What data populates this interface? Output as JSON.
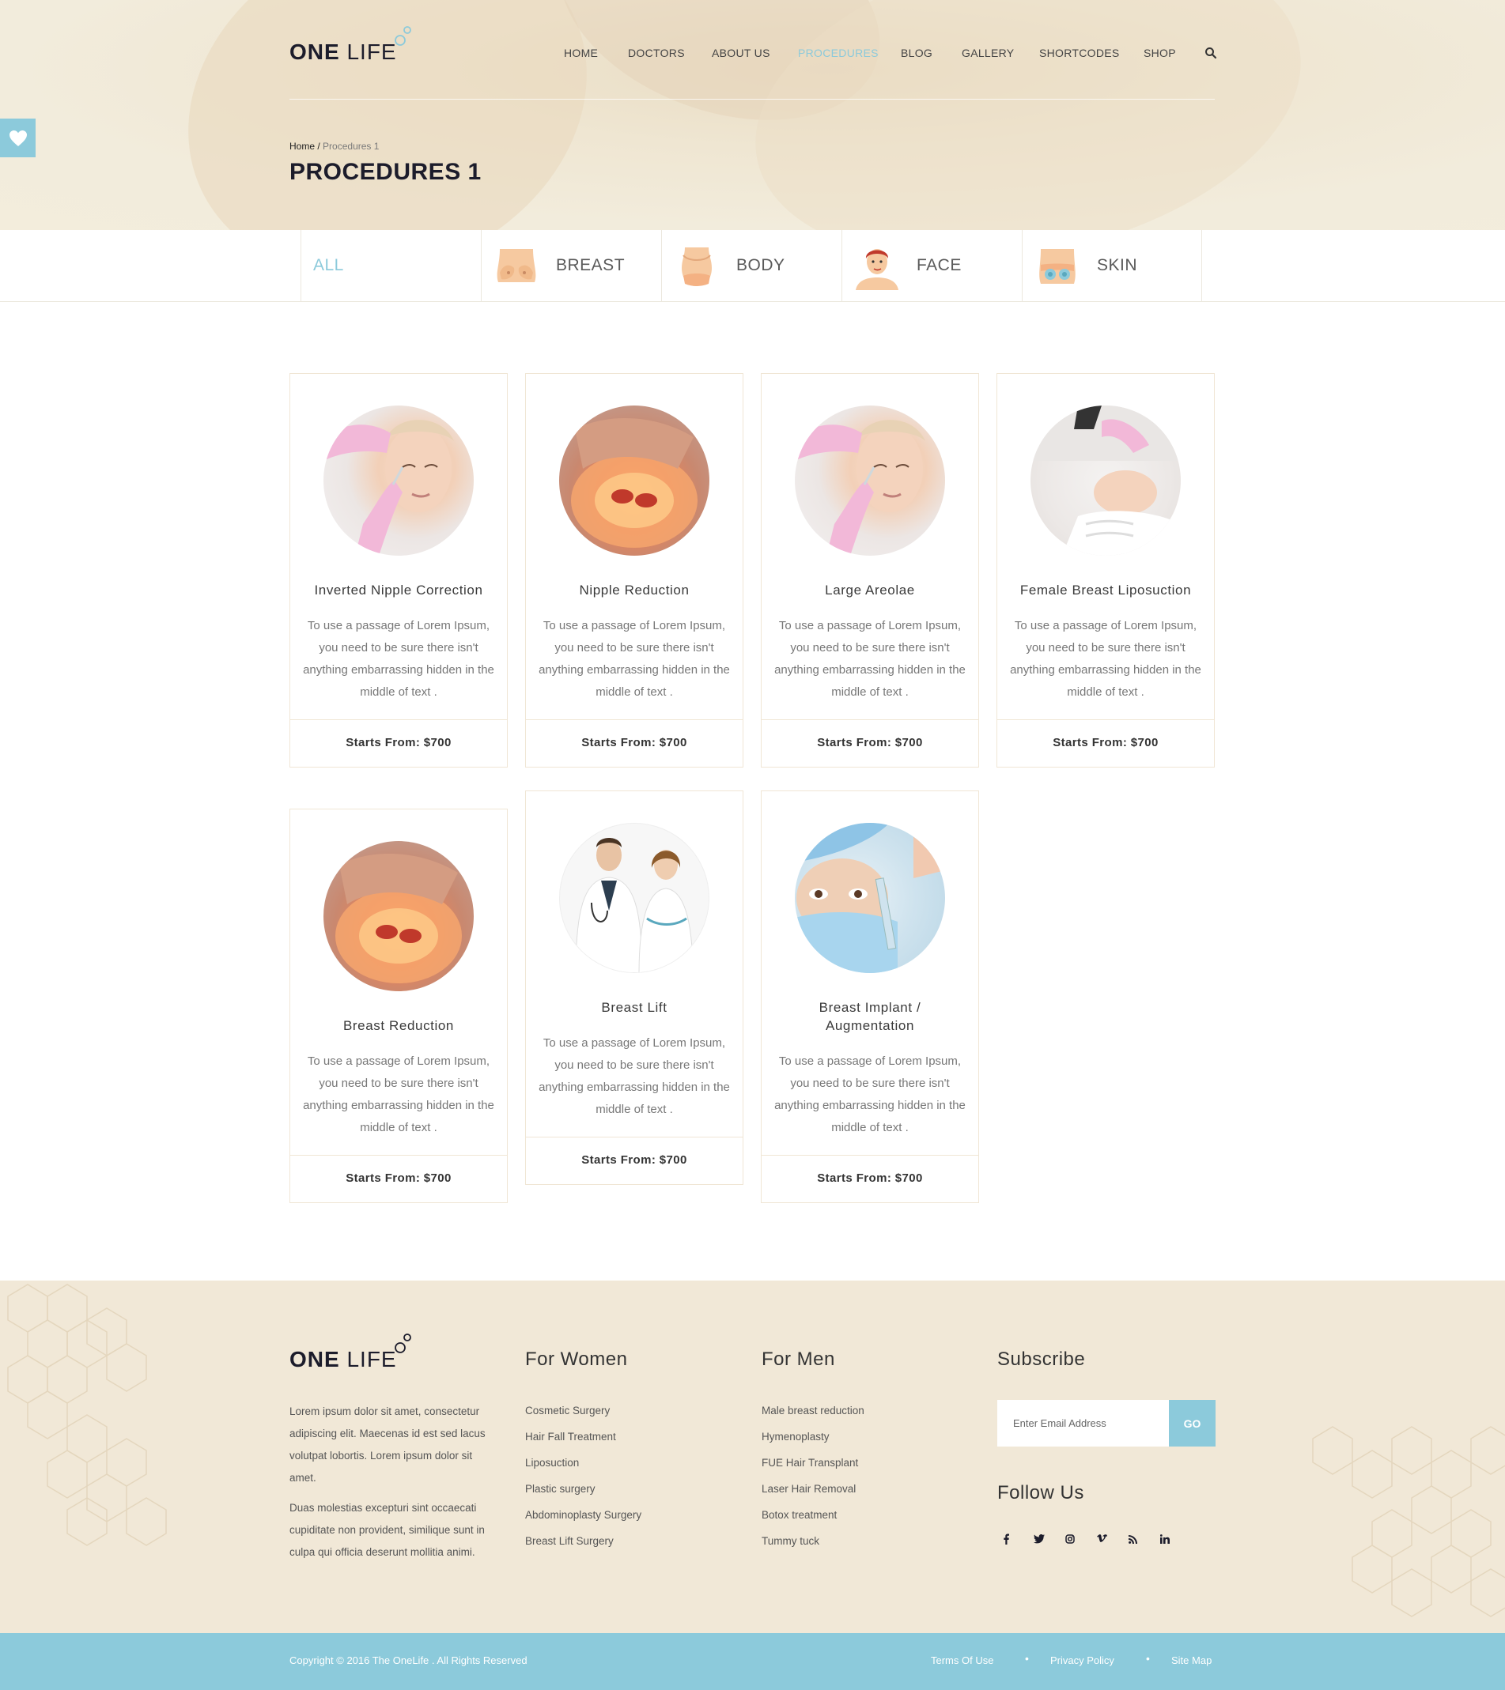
{
  "header": {
    "logo_bold": "ONE",
    "logo_light": "LIFE",
    "nav": [
      "HOME",
      "DOCTORS",
      "ABOUT US",
      "PROCEDURES",
      "BLOG",
      "GALLERY",
      "SHORTCODES",
      "SHOP"
    ],
    "active_nav": "PROCEDURES",
    "accent_color": "#8ccadb"
  },
  "breadcrumb": {
    "home": "Home",
    "separator": "/",
    "current": "Procedures 1"
  },
  "page_title": "PROCEDURES 1",
  "tabs": [
    "ALL",
    "BREAST",
    "BODY",
    "FACE",
    "SKIN"
  ],
  "cards": [
    {
      "title": "Inverted Nipple Correction",
      "desc": "To use a passage of Lorem Ipsum, you need to be sure there isn't anything embarrassing hidden in the middle of text .",
      "price": "Starts From: $700"
    },
    {
      "title": "Nipple Reduction",
      "desc": "To use a passage of Lorem Ipsum, you need to be sure there isn't anything embarrassing hidden in the middle of text .",
      "price": "Starts From: $700"
    },
    {
      "title": "Large Areolae",
      "desc": "To use a passage of Lorem Ipsum, you need to be sure there isn't anything embarrassing hidden in the middle of text .",
      "price": "Starts From: $700"
    },
    {
      "title": "Female Breast Liposuction",
      "desc": "To use a passage of Lorem Ipsum, you need to be sure there isn't anything embarrassing hidden in the middle of text .",
      "price": "Starts From: $700"
    },
    {
      "title": "Breast Reduction",
      "desc": "To use a passage of Lorem Ipsum, you need to be sure there isn't anything embarrassing hidden in the middle of text .",
      "price": "Starts From: $700"
    },
    {
      "title": "Breast Lift",
      "desc": "To use a passage of Lorem Ipsum, you need to be sure there isn't anything embarrassing hidden in the middle of text .",
      "price": "Starts From: $700"
    },
    {
      "title": "Breast Implant / Augmentation",
      "desc": "To use a passage of Lorem Ipsum, you need to be sure there isn't anything embarrassing hidden in the middle of text .",
      "price": "Starts From: $700"
    }
  ],
  "footer": {
    "logo_bold": "ONE",
    "logo_light": "LIFE",
    "about_p1": "Lorem ipsum dolor sit amet, consectetur adipiscing elit. Maecenas id est sed lacus volutpat lobortis. Lorem ipsum dolor sit amet.",
    "about_p2": "Duas molestias excepturi sint occaecati cupiditate non provident, similique sunt in culpa qui officia deserunt mollitia animi.",
    "women_title": "For Women",
    "women_links": [
      "Cosmetic Surgery",
      "Hair Fall Treatment",
      "Liposuction",
      "Plastic surgery",
      "Abdominoplasty Surgery",
      "Breast Lift Surgery"
    ],
    "men_title": "For Men",
    "men_links": [
      "Male breast reduction",
      "Hymenoplasty",
      "FUE Hair Transplant",
      "Laser Hair Removal",
      "Botox treatment",
      "Tummy tuck"
    ],
    "subscribe_title": "Subscribe",
    "subscribe_placeholder": "Enter Email Address",
    "subscribe_button": "GO",
    "follow_title": "Follow Us",
    "socials": [
      "f",
      "t",
      "ig",
      "v",
      "rss",
      "in"
    ]
  },
  "bottom": {
    "copyright": "Copyright © 2016 The OneLife . All Rights Reserved",
    "links": [
      "Terms Of Use",
      "Privacy Policy",
      "Site Map"
    ],
    "separator": "•"
  }
}
